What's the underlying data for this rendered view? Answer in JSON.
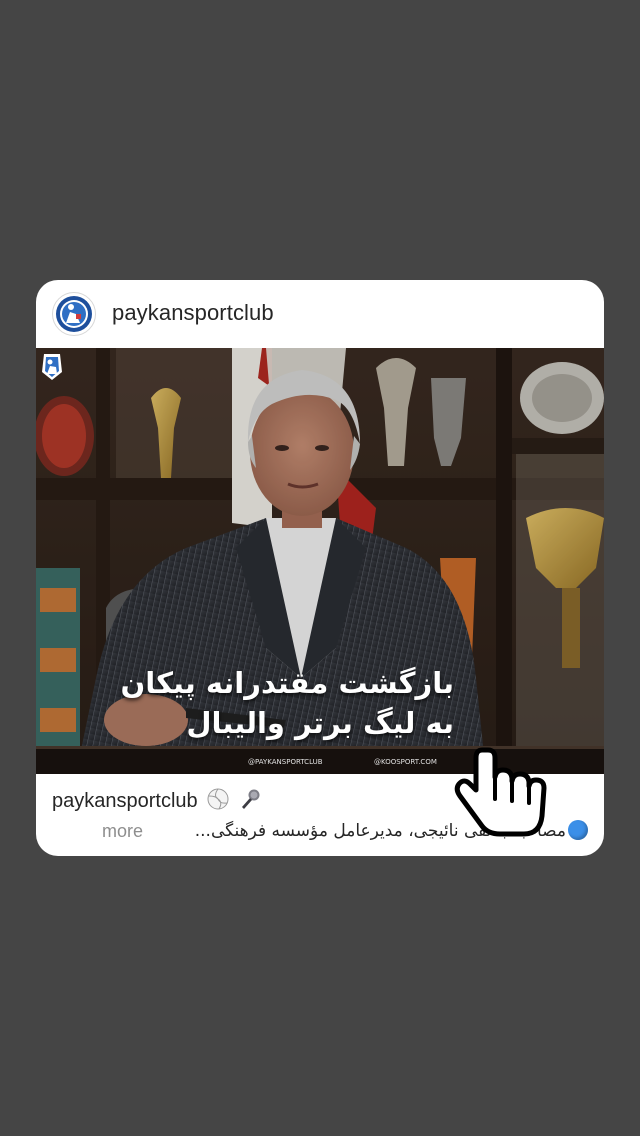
{
  "post": {
    "username": "paykansportclub",
    "overlay_line1": "بازگشت مقتدرانه پیکان",
    "overlay_line2": "به لیگ برتر والیبال",
    "watermark_left": "@PAYKANSPORTCLUB",
    "watermark_right": "@KOOSPORT.COM",
    "caption_username": "paykansportclub",
    "caption_text": "مصاحبه با نقی نائیجی، مدیرعامل مؤسسه فرهنگی...",
    "caption_more": "more"
  },
  "icons": {
    "avatar": "club-logo-icon",
    "volleyball": "volleyball-icon",
    "microphone": "microphone-icon",
    "blue_circle": "blue-circle-icon",
    "pointer": "pointing-hand-cursor-icon"
  },
  "colors": {
    "background": "#454545",
    "card": "#ffffff",
    "text": "#262626",
    "muted": "#8e8e8e",
    "blue": "#3b8fe8"
  }
}
